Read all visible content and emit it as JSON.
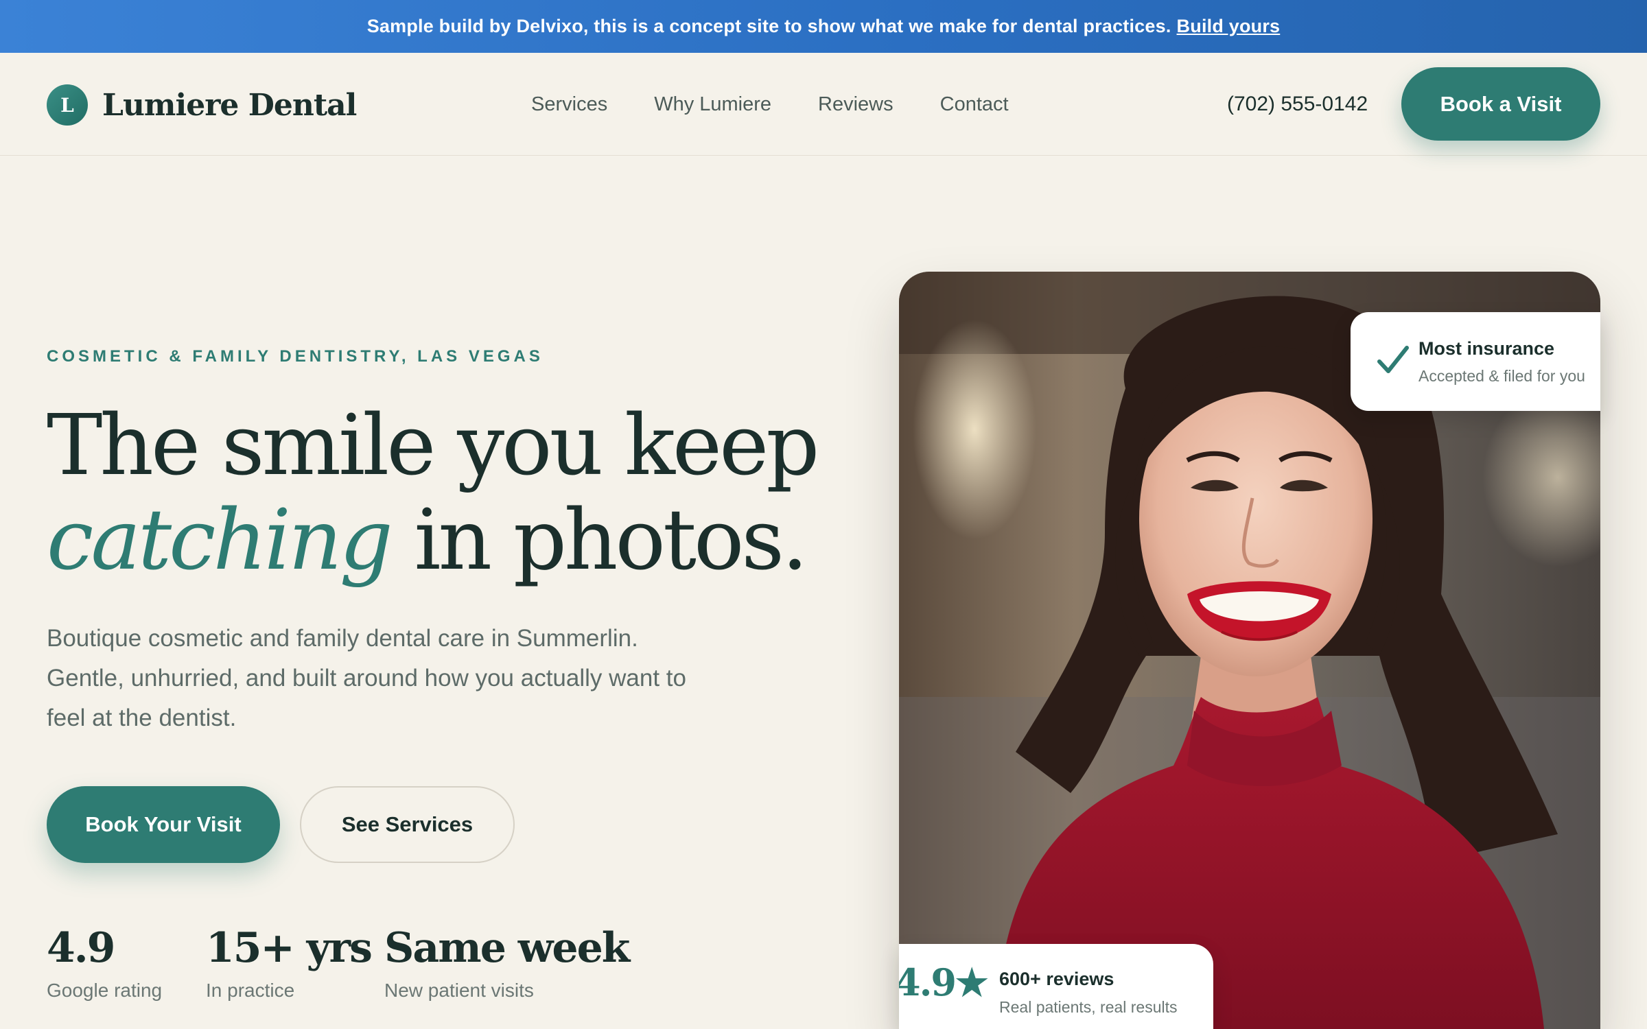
{
  "banner": {
    "text": "Sample build by Delvixo, this is a concept site to show what we make for dental practices.",
    "link": "Build yours"
  },
  "header": {
    "logo_letter": "L",
    "brand": "Lumiere Dental",
    "nav": [
      "Services",
      "Why Lumiere",
      "Reviews",
      "Contact"
    ],
    "phone": "(702) 555-0142",
    "cta": "Book a Visit"
  },
  "hero": {
    "eyebrow": "COSMETIC & FAMILY DENTISTRY, LAS VEGAS",
    "headline_line1": "The smile you keep",
    "headline_accent": "catching",
    "headline_rest": " in photos.",
    "lead": "Boutique cosmetic and family dental care in Summerlin. Gentle, unhurried, and built around how you actually want to feel at the dentist.",
    "primary_cta": "Book Your Visit",
    "secondary_cta": "See Services",
    "stats": [
      {
        "value": "4.9",
        "label": "Google rating"
      },
      {
        "value": "15+ yrs",
        "label": "In practice"
      },
      {
        "value": "Same week",
        "label": "New patient visits"
      }
    ]
  },
  "insurance_card": {
    "icon": "checkmark-icon",
    "title": "Most insurance",
    "subtitle": "Accepted & filed for you"
  },
  "reviews_card": {
    "rating": "4.9★",
    "title": "600+ reviews",
    "subtitle": "Real patients, real results"
  },
  "colors": {
    "background": "#f5f2ea",
    "accent": "#2e7c73",
    "text": "#1b2f2c",
    "banner": "#2b6fc2"
  }
}
